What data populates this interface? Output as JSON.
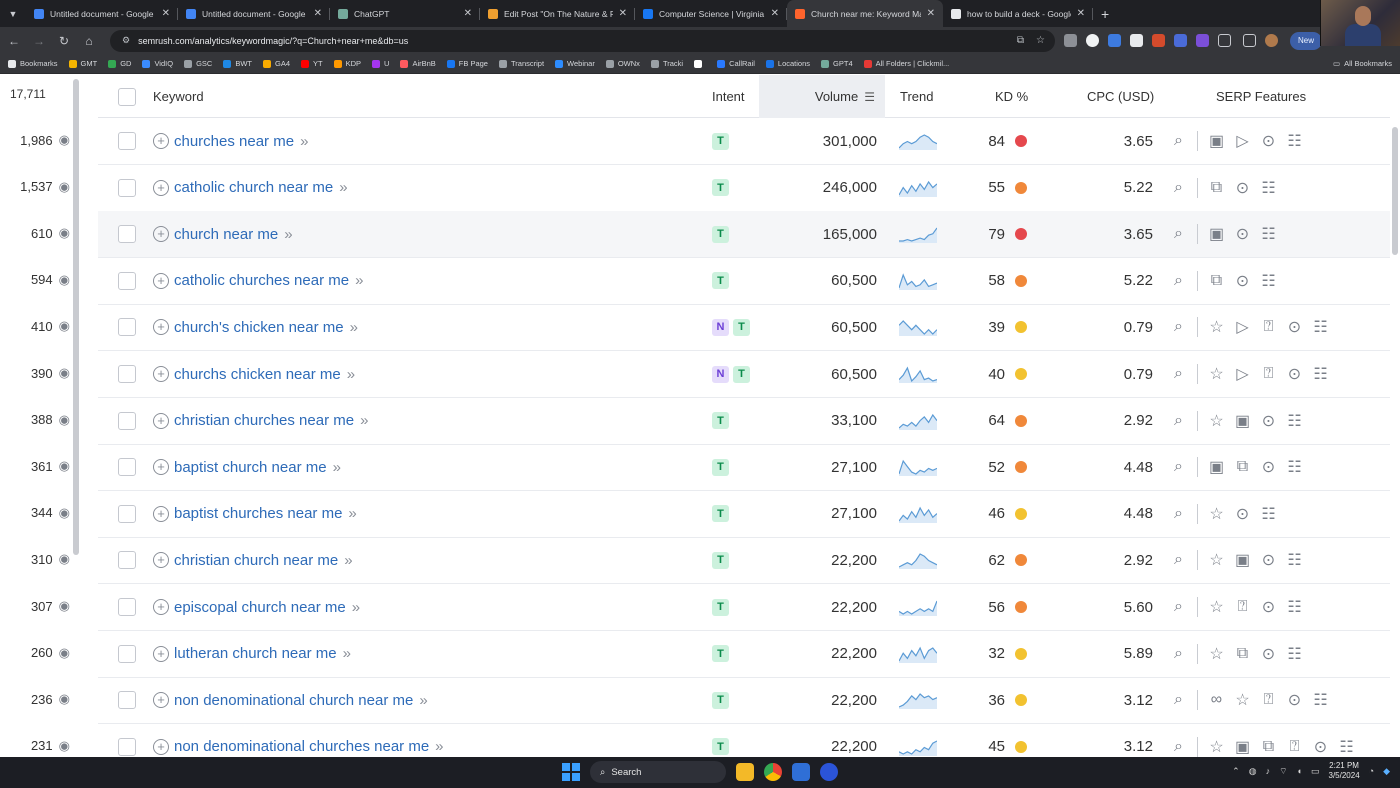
{
  "browser": {
    "tabs": [
      {
        "title": "Untitled document - Google Do",
        "favicon_color": "#4285f4",
        "active": false
      },
      {
        "title": "Untitled document - Google Do",
        "favicon_color": "#4285f4",
        "active": false
      },
      {
        "title": "ChatGPT",
        "favicon_color": "#74aa9c",
        "active": false
      },
      {
        "title": "Edit Post \"On The Nature & Per",
        "favicon_color": "#f0a030",
        "active": false
      },
      {
        "title": "Computer Science | Virginia De",
        "favicon_color": "#1877f2",
        "active": false
      },
      {
        "title": "Church near me: Keyword Magi",
        "favicon_color": "#ff642d",
        "active": true
      },
      {
        "title": "how to build a deck - Google S",
        "favicon_color": "#e8eaed",
        "active": false
      }
    ],
    "url": "semrush.com/analytics/keywordmagic/?q=Church+near+me&db=us",
    "new_button_label": "New",
    "bookmarks": [
      {
        "label": "Bookmarks",
        "color": "#e8eaed"
      },
      {
        "label": "GMT",
        "color": "#f4b400"
      },
      {
        "label": "GD",
        "color": "#34a853"
      },
      {
        "label": "VidIQ",
        "color": "#3a8bff"
      },
      {
        "label": "GSC",
        "color": "#9aa0a6"
      },
      {
        "label": "BWT",
        "color": "#1e88e5"
      },
      {
        "label": "GA4",
        "color": "#f9ab00"
      },
      {
        "label": "YT",
        "color": "#ff0000"
      },
      {
        "label": "KDP",
        "color": "#ff9900"
      },
      {
        "label": "U",
        "color": "#a435f0"
      },
      {
        "label": "AirBnB",
        "color": "#ff5a5f"
      },
      {
        "label": "FB Page",
        "color": "#1877f2"
      },
      {
        "label": "Transcript",
        "color": "#9aa0a6"
      },
      {
        "label": "Webinar",
        "color": "#2d8cff"
      },
      {
        "label": "OWNx",
        "color": "#9aa0a6"
      },
      {
        "label": "Tracki",
        "color": "#9aa0a6"
      },
      {
        "label": "",
        "color": "#ffffff"
      },
      {
        "label": "CallRail",
        "color": "#2979ff"
      },
      {
        "label": "Locations",
        "color": "#1a73e8"
      },
      {
        "label": "GPT4",
        "color": "#74aa9c"
      },
      {
        "label": "All Folders | Clickmil...",
        "color": "#e53935"
      }
    ],
    "all_bookmarks": "All Bookmarks"
  },
  "left_panel": {
    "total": "17,711",
    "counts": [
      "1,986",
      "1,537",
      "610",
      "594",
      "410",
      "390",
      "388",
      "361",
      "344",
      "310",
      "307",
      "260",
      "236",
      "231"
    ]
  },
  "table": {
    "headers": {
      "keyword": "Keyword",
      "intent": "Intent",
      "volume": "Volume",
      "trend": "Trend",
      "kd": "KD %",
      "cpc": "CPC (USD)",
      "serp": "SERP Features"
    },
    "rows": [
      {
        "keyword": "churches near me",
        "intents": [
          "T"
        ],
        "volume": "301,000",
        "kd": "84",
        "kd_color": "#e5484d",
        "cpc": "3.65",
        "trend": [
          6,
          8,
          9,
          8,
          9,
          11,
          12,
          11,
          9,
          8
        ],
        "serp": [
          "image-icon",
          "video-icon",
          "location-pin-icon",
          "list-icon"
        ]
      },
      {
        "keyword": "catholic church near me",
        "intents": [
          "T"
        ],
        "volume": "246,000",
        "kd": "55",
        "kd_color": "#f0883a",
        "cpc": "5.22",
        "trend": [
          5,
          9,
          6,
          10,
          7,
          11,
          8,
          12,
          9,
          11
        ],
        "serp": [
          "images-icon",
          "location-pin-icon",
          "list-icon"
        ]
      },
      {
        "keyword": "church near me",
        "intents": [
          "T"
        ],
        "volume": "165,000",
        "kd": "79",
        "kd_color": "#e5484d",
        "cpc": "3.65",
        "trend": [
          5,
          5,
          6,
          5,
          6,
          7,
          6,
          9,
          10,
          14
        ],
        "serp": [
          "image-icon",
          "location-pin-icon",
          "list-icon"
        ]
      },
      {
        "keyword": "catholic churches near me",
        "intents": [
          "T"
        ],
        "volume": "60,500",
        "kd": "58",
        "kd_color": "#f0883a",
        "cpc": "5.22",
        "trend": [
          4,
          12,
          6,
          8,
          5,
          6,
          9,
          5,
          6,
          7
        ],
        "serp": [
          "images-icon",
          "location-pin-icon",
          "list-icon"
        ]
      },
      {
        "keyword": "church's chicken near me",
        "intents": [
          "N",
          "T"
        ],
        "volume": "60,500",
        "kd": "39",
        "kd_color": "#f2c230",
        "cpc": "0.79",
        "trend": [
          10,
          11,
          10,
          9,
          10,
          9,
          8,
          9,
          8,
          9
        ],
        "serp": [
          "star-icon",
          "video-icon",
          "faq-icon",
          "location-pin-icon",
          "list-icon"
        ]
      },
      {
        "keyword": "churchs chicken near me",
        "intents": [
          "N",
          "T"
        ],
        "volume": "60,500",
        "kd": "40",
        "kd_color": "#f2c230",
        "cpc": "0.79",
        "trend": [
          6,
          9,
          14,
          5,
          8,
          12,
          6,
          7,
          5,
          6
        ],
        "serp": [
          "star-icon",
          "video-icon",
          "faq-icon",
          "location-pin-icon",
          "list-icon"
        ]
      },
      {
        "keyword": "christian churches near me",
        "intents": [
          "T"
        ],
        "volume": "33,100",
        "kd": "64",
        "kd_color": "#f0883a",
        "cpc": "2.92",
        "trend": [
          5,
          7,
          6,
          8,
          6,
          9,
          11,
          8,
          12,
          9
        ],
        "serp": [
          "star-icon",
          "image-icon",
          "location-pin-icon",
          "list-icon"
        ]
      },
      {
        "keyword": "baptist church near me",
        "intents": [
          "T"
        ],
        "volume": "27,100",
        "kd": "52",
        "kd_color": "#f0883a",
        "cpc": "4.48",
        "trend": [
          5,
          12,
          9,
          6,
          5,
          7,
          6,
          8,
          7,
          8
        ],
        "serp": [
          "image-icon",
          "images-icon",
          "location-pin-icon",
          "list-icon"
        ]
      },
      {
        "keyword": "baptist churches near me",
        "intents": [
          "T"
        ],
        "volume": "27,100",
        "kd": "46",
        "kd_color": "#f2c230",
        "cpc": "4.48",
        "trend": [
          6,
          9,
          7,
          11,
          8,
          13,
          9,
          12,
          8,
          10
        ],
        "serp": [
          "star-icon",
          "location-pin-icon",
          "list-icon"
        ]
      },
      {
        "keyword": "christian church near me",
        "intents": [
          "T"
        ],
        "volume": "22,200",
        "kd": "62",
        "kd_color": "#f0883a",
        "cpc": "2.92",
        "trend": [
          6,
          7,
          8,
          7,
          9,
          12,
          11,
          9,
          8,
          7
        ],
        "serp": [
          "star-icon",
          "image-icon",
          "location-pin-icon",
          "list-icon"
        ]
      },
      {
        "keyword": "episcopal church near me",
        "intents": [
          "T"
        ],
        "volume": "22,200",
        "kd": "56",
        "kd_color": "#f0883a",
        "cpc": "5.60",
        "trend": [
          9,
          8,
          9,
          8,
          9,
          10,
          9,
          10,
          9,
          13
        ],
        "serp": [
          "star-icon",
          "faq-icon",
          "location-pin-icon",
          "list-icon"
        ]
      },
      {
        "keyword": "lutheran church near me",
        "intents": [
          "T"
        ],
        "volume": "22,200",
        "kd": "32",
        "kd_color": "#f2c230",
        "cpc": "5.89",
        "trend": [
          7,
          10,
          8,
          11,
          9,
          12,
          8,
          11,
          12,
          10
        ],
        "serp": [
          "star-icon",
          "images-icon",
          "location-pin-icon",
          "list-icon"
        ]
      },
      {
        "keyword": "non denominational church near me",
        "intents": [
          "T"
        ],
        "volume": "22,200",
        "kd": "36",
        "kd_color": "#f2c230",
        "cpc": "3.12",
        "trend": [
          5,
          6,
          8,
          11,
          9,
          12,
          10,
          11,
          9,
          10
        ],
        "serp": [
          "link-icon",
          "star-icon",
          "faq-icon",
          "location-pin-icon",
          "list-icon"
        ]
      },
      {
        "keyword": "non denominational churches near me",
        "intents": [
          "T"
        ],
        "volume": "22,200",
        "kd": "45",
        "kd_color": "#f2c230",
        "cpc": "3.12",
        "trend": [
          7,
          6,
          7,
          6,
          8,
          7,
          9,
          8,
          11,
          12
        ],
        "serp": [
          "star-icon",
          "image-icon",
          "images-icon",
          "faq-icon",
          "location-pin-icon",
          "list-icon"
        ]
      }
    ]
  },
  "taskbar": {
    "search_label": "Search",
    "time": "2:21 PM",
    "date": "3/5/2024"
  },
  "colors": {
    "keyword_link": "#2e6bb8",
    "intent_transactional_bg": "#ccf1dd",
    "intent_navigational_bg": "#e5dcfb",
    "trend_line": "#5b9bd5",
    "trend_fill": "#dbe9f7"
  }
}
